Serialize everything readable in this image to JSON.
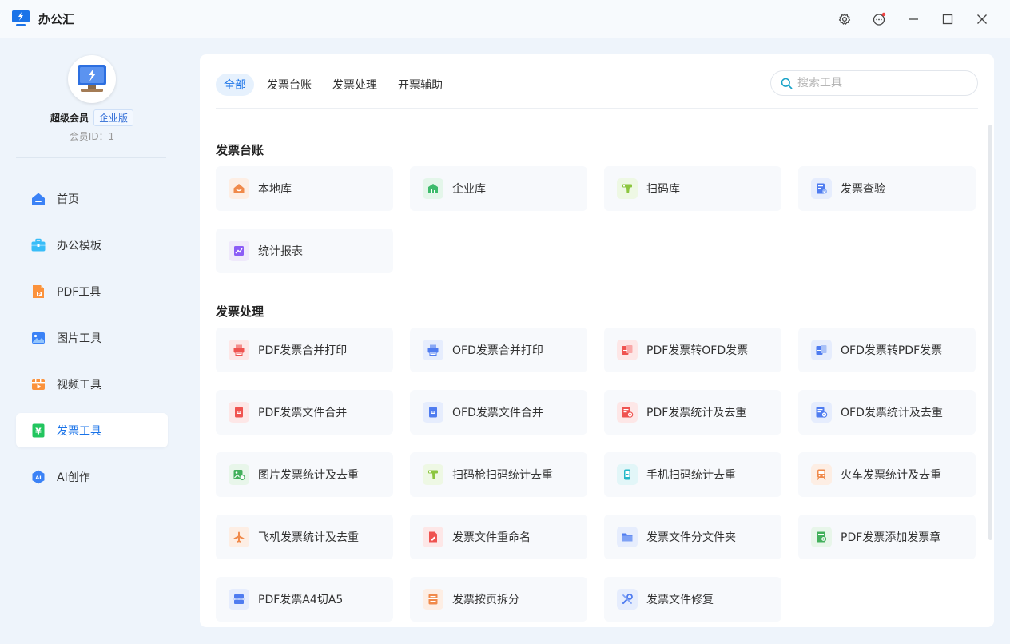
{
  "app": {
    "title": "办公汇"
  },
  "user": {
    "level": "超级会员",
    "badge": "企业版",
    "id_text": "会员ID：1"
  },
  "sidebar": {
    "items": [
      {
        "label": "首页",
        "icon": "home-icon",
        "color": "#3b82f6"
      },
      {
        "label": "办公模板",
        "icon": "briefcase-icon",
        "color": "#38bdf8"
      },
      {
        "label": "PDF工具",
        "icon": "pdf-file-icon",
        "color": "#f97316"
      },
      {
        "label": "图片工具",
        "icon": "image-icon",
        "color": "#3b82f6"
      },
      {
        "label": "视频工具",
        "icon": "video-icon",
        "color": "#fb923c"
      },
      {
        "label": "发票工具",
        "icon": "invoice-yen-icon",
        "color": "#22c55e",
        "active": true
      },
      {
        "label": "AI创作",
        "icon": "ai-hexagon-icon",
        "color": "#3b82f6"
      }
    ]
  },
  "tabs": [
    "全部",
    "发票台账",
    "发票处理",
    "开票辅助"
  ],
  "search": {
    "placeholder": "搜索工具"
  },
  "sections": [
    {
      "title": "发票台账",
      "tools": [
        {
          "label": "本地库",
          "icon": "house-icon",
          "bg": "#fdeee4",
          "fg": "#f08a4b"
        },
        {
          "label": "企业库",
          "icon": "building-icon",
          "bg": "#e4f6ea",
          "fg": "#3dbb6b"
        },
        {
          "label": "扫码库",
          "icon": "scanner-gun-icon",
          "bg": "#eef8e4",
          "fg": "#8cc63f"
        },
        {
          "label": "发票查验",
          "icon": "invoice-check-icon",
          "bg": "#e6edfd",
          "fg": "#4f7cf0"
        },
        {
          "label": "统计报表",
          "icon": "chart-report-icon",
          "bg": "#efe9fb",
          "fg": "#8b5cf6"
        }
      ]
    },
    {
      "title": "发票处理",
      "tools": [
        {
          "label": "PDF发票合并打印",
          "icon": "printer-icon",
          "bg": "#fde7e7",
          "fg": "#ef5350"
        },
        {
          "label": "OFD发票合并打印",
          "icon": "printer-icon",
          "bg": "#e6edfd",
          "fg": "#4f7cf0"
        },
        {
          "label": "PDF发票转OFD发票",
          "icon": "convert-pdf-ofd-icon",
          "bg": "#fde7e7",
          "fg": "#ef5350"
        },
        {
          "label": "OFD发票转PDF发票",
          "icon": "convert-ofd-pdf-icon",
          "bg": "#e6edfd",
          "fg": "#4f7cf0"
        },
        {
          "label": "PDF发票文件合并",
          "icon": "merge-file-icon",
          "bg": "#fde7e7",
          "fg": "#ef5350"
        },
        {
          "label": "OFD发票文件合并",
          "icon": "merge-file-icon",
          "bg": "#e6edfd",
          "fg": "#4f7cf0"
        },
        {
          "label": "PDF发票统计及去重",
          "icon": "dedupe-file-icon",
          "bg": "#fde7e7",
          "fg": "#ef5350"
        },
        {
          "label": "OFD发票统计及去重",
          "icon": "dedupe-file-icon",
          "bg": "#e6edfd",
          "fg": "#4f7cf0"
        },
        {
          "label": "图片发票统计及去重",
          "icon": "image-dedupe-icon",
          "bg": "#e8f6ea",
          "fg": "#43b05c"
        },
        {
          "label": "扫码枪扫码统计去重",
          "icon": "scanner-gun-icon",
          "bg": "#eef8e4",
          "fg": "#8cc63f"
        },
        {
          "label": "手机扫码统计去重",
          "icon": "phone-scan-icon",
          "bg": "#e2f6f8",
          "fg": "#22b8c8"
        },
        {
          "label": "火车发票统计及去重",
          "icon": "train-icon",
          "bg": "#fdeee4",
          "fg": "#f08a4b"
        },
        {
          "label": "飞机发票统计及去重",
          "icon": "airplane-icon",
          "bg": "#fdeee4",
          "fg": "#f08a4b"
        },
        {
          "label": "发票文件重命名",
          "icon": "rename-icon",
          "bg": "#fde7e7",
          "fg": "#ef5350"
        },
        {
          "label": "发票文件分文件夹",
          "icon": "folder-icon",
          "bg": "#e6edfd",
          "fg": "#4f7cf0"
        },
        {
          "label": "PDF发票添加发票章",
          "icon": "stamp-icon",
          "bg": "#e8f6ea",
          "fg": "#43b05c"
        },
        {
          "label": "PDF发票A4切A5",
          "icon": "split-page-icon",
          "bg": "#e6edfd",
          "fg": "#4f7cf0"
        },
        {
          "label": "发票按页拆分",
          "icon": "page-split-icon",
          "bg": "#fdeee4",
          "fg": "#f08a4b"
        },
        {
          "label": "发票文件修复",
          "icon": "repair-tools-icon",
          "bg": "#e6edfd",
          "fg": "#4f7cf0"
        }
      ]
    }
  ]
}
